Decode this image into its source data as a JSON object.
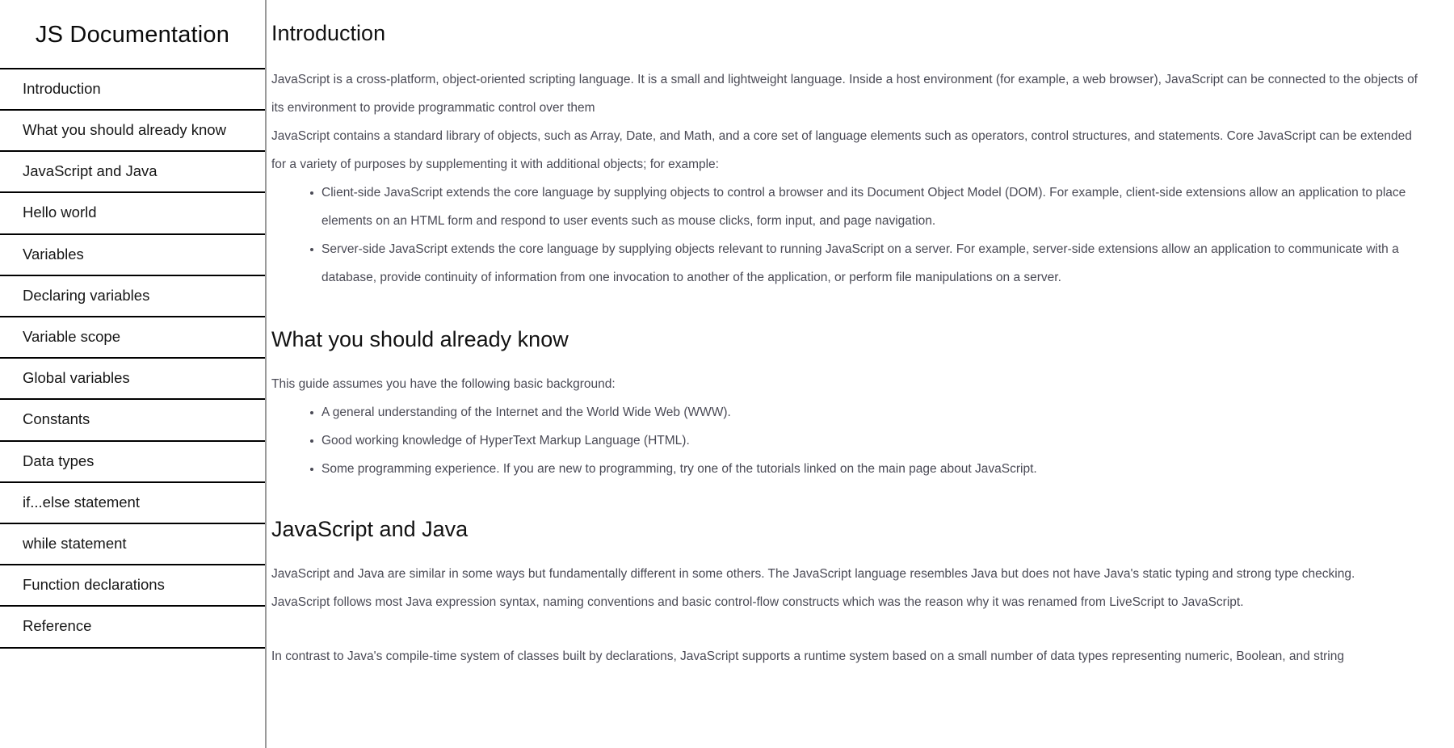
{
  "sidebar": {
    "title": "JS Documentation",
    "items": [
      {
        "label": "Introduction"
      },
      {
        "label": "What you should already know"
      },
      {
        "label": "JavaScript and Java"
      },
      {
        "label": "Hello world"
      },
      {
        "label": "Variables"
      },
      {
        "label": "Declaring variables"
      },
      {
        "label": "Variable scope"
      },
      {
        "label": "Global variables"
      },
      {
        "label": "Constants"
      },
      {
        "label": "Data types"
      },
      {
        "label": "if...else statement"
      },
      {
        "label": "while statement"
      },
      {
        "label": "Function declarations"
      },
      {
        "label": "Reference"
      }
    ]
  },
  "main": {
    "sections": [
      {
        "id": "Introduction",
        "header": "Introduction",
        "paragraphs": [
          "JavaScript is a cross-platform, object-oriented scripting language. It is a small and lightweight language. Inside a host environment (for example, a web browser), JavaScript can be connected to the objects of its environment to provide programmatic control over them",
          "JavaScript contains a standard library of objects, such as Array, Date, and Math, and a core set of language elements such as operators, control structures, and statements. Core JavaScript can be extended for a variety of purposes by supplementing it with additional objects; for example:"
        ],
        "list": [
          "Client-side JavaScript extends the core language by supplying objects to control a browser and its Document Object Model (DOM). For example, client-side extensions allow an application to place elements on an HTML form and respond to user events such as mouse clicks, form input, and page navigation.",
          "Server-side JavaScript extends the core language by supplying objects relevant to running JavaScript on a server. For example, server-side extensions allow an application to communicate with a database, provide continuity of information from one invocation to another of the application, or perform file manipulations on a server."
        ]
      },
      {
        "id": "WhatYouShouldAlreadyKnow",
        "header": "What you should already know",
        "paragraphs": [
          "This guide assumes you have the following basic background:"
        ],
        "list": [
          "A general understanding of the Internet and the World Wide Web (WWW).",
          "Good working knowledge of HyperText Markup Language (HTML).",
          "Some programming experience. If you are new to programming, try one of the tutorials linked on the main page about JavaScript."
        ]
      },
      {
        "id": "JavaScriptAndJava",
        "header": "JavaScript and Java",
        "paragraphs": [
          "JavaScript and Java are similar in some ways but fundamentally different in some others. The JavaScript language resembles Java but does not have Java's static typing and strong type checking.",
          "JavaScript follows most Java expression syntax, naming conventions and basic control-flow constructs which was the reason why it was renamed from LiveScript to JavaScript.",
          "In contrast to Java's compile-time system of classes built by declarations, JavaScript supports a runtime system based on a small number of data types representing numeric, Boolean, and string"
        ],
        "list": []
      }
    ]
  },
  "colors": {
    "sidebar_border": "#9a9a9a",
    "nav_divider": "#000000",
    "heading": "#121212",
    "body_text": "#4a4a55",
    "background": "#ffffff"
  }
}
